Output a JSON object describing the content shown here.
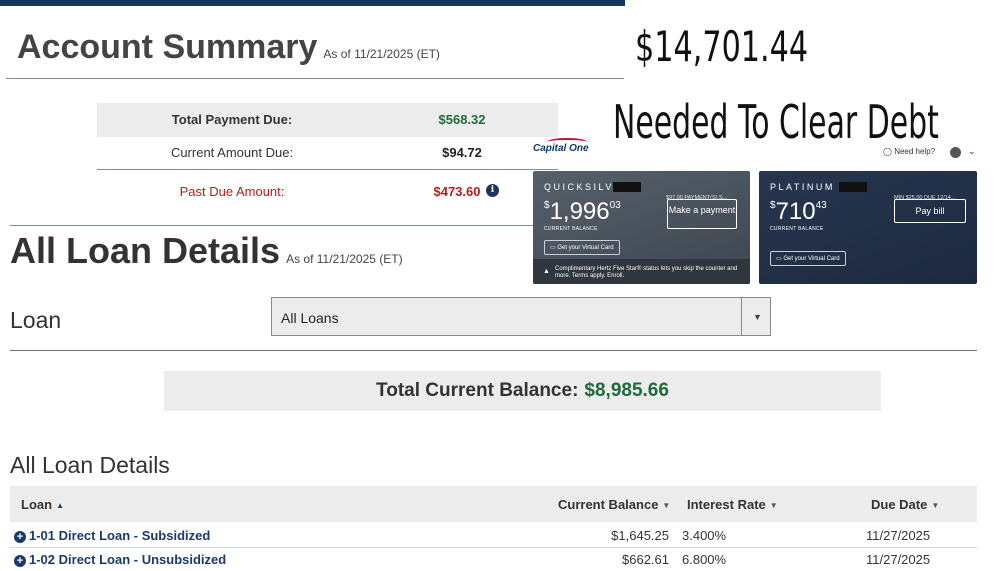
{
  "account_summary": {
    "title": "Account Summary",
    "as_of": "As of 11/21/2025 (ET)",
    "total_payment_due_label": "Total Payment Due:",
    "total_payment_due": "$568.32",
    "current_amount_due_label": "Current Amount Due:",
    "current_amount_due": "$94.72",
    "past_due_label": "Past Due Amount:",
    "past_due": "$473.60"
  },
  "overlay": {
    "amount": "$14,701.44",
    "caption": "Needed To Clear Debt"
  },
  "capital_one": {
    "logo": "Capital One",
    "need_help": "Need help?",
    "cards": [
      {
        "name": "QUICKSILVER",
        "note": "$97.00 PAYMENT(S) S...",
        "balance_dollars": "1,996",
        "balance_cents": "03",
        "balance_label": "CURRENT BALANCE",
        "button": "Make a payment",
        "virtual_card": "Get your Virtual Card",
        "promo": "Complimentary Hertz Five Star® status lets you skip the counter and more. Terms apply. Enroll."
      },
      {
        "name": "PLATINUM",
        "note": "MIN $25.00 DUE 12/14...",
        "balance_dollars": "710",
        "balance_cents": "43",
        "balance_label": "CURRENT BALANCE",
        "button": "Pay bill",
        "virtual_card": "Get your Virtual Card"
      }
    ]
  },
  "loan_details": {
    "title": "All Loan Details",
    "as_of": "As of 11/21/2025 (ET)",
    "loan_label": "Loan",
    "select_value": "All Loans",
    "total_label": "Total Current Balance:",
    "total_value": "$8,985.66",
    "table_title": "All Loan Details",
    "columns": [
      "Loan",
      "Current Balance",
      "Interest Rate",
      "Due Date"
    ],
    "rows": [
      {
        "name": "1-01 Direct Loan - Subsidized",
        "balance": "$1,645.25",
        "rate": "3.400%",
        "due": "11/27/2025"
      },
      {
        "name": "1-02 Direct Loan - Unsubsidized",
        "balance": "$662.61",
        "rate": "6.800%",
        "due": "11/27/2025"
      }
    ]
  }
}
